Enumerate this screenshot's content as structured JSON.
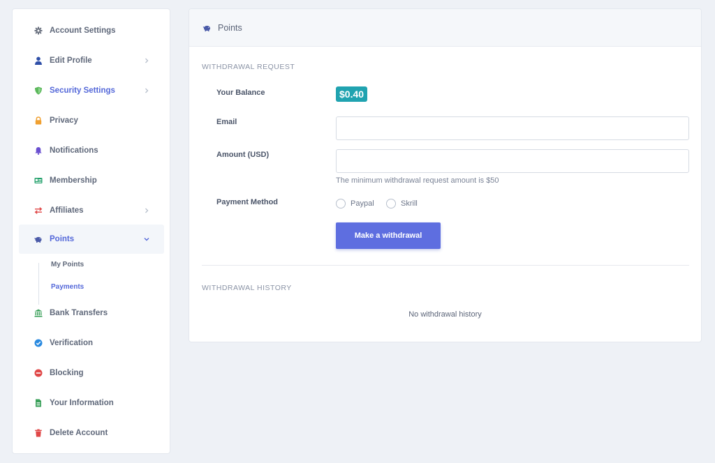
{
  "sidebar": {
    "items": [
      {
        "label": "Account Settings",
        "icon": "gear-icon",
        "color": "#6b7280"
      },
      {
        "label": "Edit Profile",
        "icon": "user-icon",
        "color": "#2f4fa8"
      },
      {
        "label": "Security Settings",
        "icon": "shield-icon",
        "color": "#5cb85c"
      },
      {
        "label": "Privacy",
        "icon": "lock-icon",
        "color": "#f0a030"
      },
      {
        "label": "Notifications",
        "icon": "bell-icon",
        "color": "#6a4fd0"
      },
      {
        "label": "Membership",
        "icon": "id-card-icon",
        "color": "#22a06b"
      },
      {
        "label": "Affiliates",
        "icon": "exchange-icon",
        "color": "#e04848"
      },
      {
        "label": "Points",
        "icon": "piggy-bank-icon",
        "color": "#4a5aa8"
      },
      {
        "label": "Bank Transfers",
        "icon": "bank-icon",
        "color": "#3aa05a"
      },
      {
        "label": "Verification",
        "icon": "check-badge-icon",
        "color": "#2a8ae0"
      },
      {
        "label": "Blocking",
        "icon": "block-icon",
        "color": "#e04848"
      },
      {
        "label": "Your Information",
        "icon": "document-icon",
        "color": "#3aa05a"
      },
      {
        "label": "Delete Account",
        "icon": "trash-icon",
        "color": "#e04848"
      }
    ],
    "sub_items": [
      {
        "label": "My Points"
      },
      {
        "label": "Payments"
      }
    ]
  },
  "card": {
    "title": "Points",
    "withdrawal_request_title": "WITHDRAWAL REQUEST",
    "balance_label": "Your Balance",
    "balance_value": "$0.40",
    "email_label": "Email",
    "email_value": "",
    "amount_label": "Amount (USD)",
    "amount_value": "",
    "amount_hint": "The minimum withdrawal request amount is $50",
    "payment_method_label": "Payment Method",
    "payment_options": [
      "Paypal",
      "Skrill"
    ],
    "submit_label": "Make a withdrawal",
    "history_title": "WITHDRAWAL HISTORY",
    "history_empty": "No withdrawal history"
  },
  "colors": {
    "accent": "#5e6ee0",
    "badge": "#20a3b0",
    "active_text": "#5468d9"
  }
}
